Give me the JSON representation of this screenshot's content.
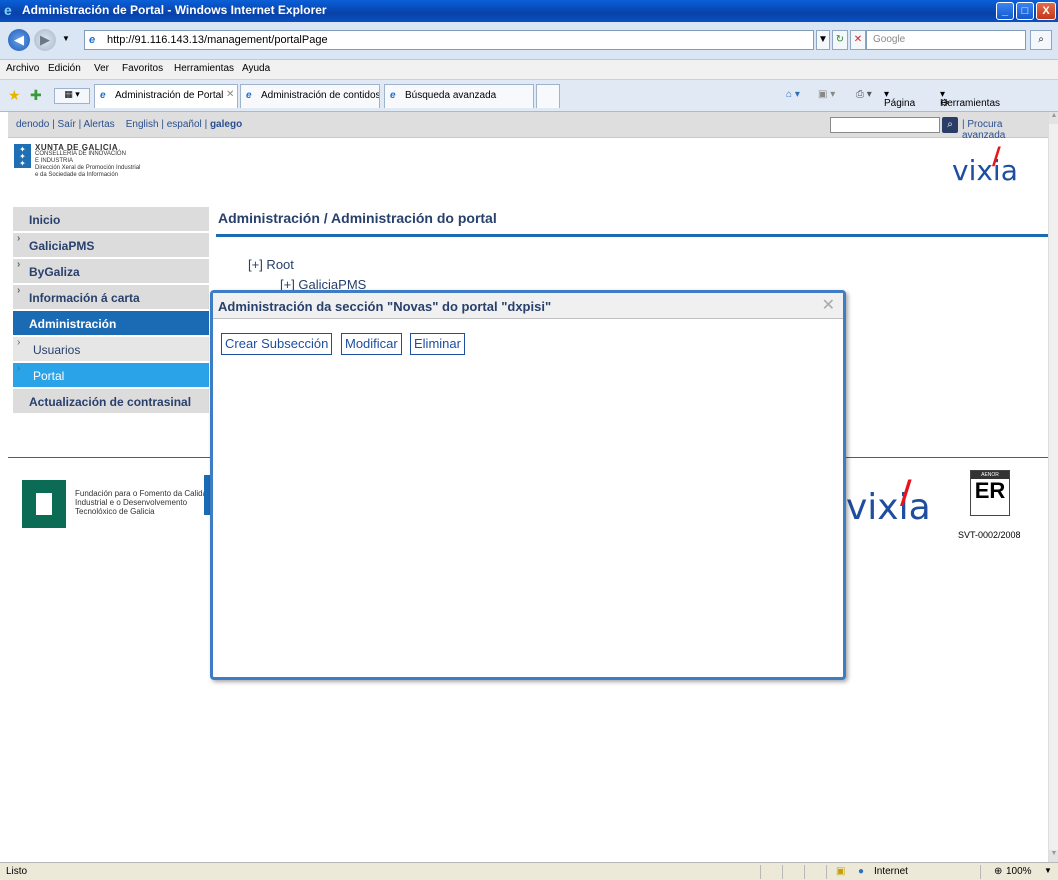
{
  "window": {
    "title": "Administración de Portal - Windows Internet Explorer",
    "minimize_label": "_",
    "maximize_label": "□",
    "close_label": "X"
  },
  "addressbar": {
    "back_glyph": "◀",
    "forward_glyph": "▶",
    "url": "http://91.116.143.13/management/portalPage",
    "refresh_glyph": "↻",
    "stop_glyph": "✕",
    "search_placeholder": "Google"
  },
  "menubar": [
    "Archivo",
    "Edición",
    "Ver",
    "Favoritos",
    "Herramientas",
    "Ayuda"
  ],
  "tabs": [
    {
      "label": "Administración de Portal",
      "active": true
    },
    {
      "label": "Administración de contidos",
      "active": false
    },
    {
      "label": "Búsqueda avanzada",
      "active": false
    }
  ],
  "toolbar": {
    "page_label": "Página",
    "tools_label": "Herramientas"
  },
  "site": {
    "topstrip": {
      "user": "denodo",
      "sair": "Saír",
      "alertas": "Alertas",
      "lang_en": "English",
      "lang_es": "español",
      "lang_gl": "galego",
      "separator": "|",
      "advanced_search": "Procura avanzada"
    },
    "xunta": {
      "name": "XUNTA DE GALICIA",
      "line1": "CONSELLERÍA DE INNOVACIÓN",
      "line2": "E INDUSTRIA",
      "line3": "Dirección Xeral de Promoción Industrial",
      "line4": "e da Sociedade da Información"
    },
    "vixia_logo": "vixia",
    "sidebar": [
      {
        "label": "Inicio",
        "type": "main"
      },
      {
        "label": "GaliciaPMS",
        "type": "arrow"
      },
      {
        "label": "ByGaliza",
        "type": "arrow"
      },
      {
        "label": "Información á carta",
        "type": "arrow"
      },
      {
        "label": "Administración",
        "type": "active"
      },
      {
        "label": "Usuarios",
        "type": "sub"
      },
      {
        "label": "Portal",
        "type": "subsel"
      },
      {
        "label": "Actualización de contrasinal",
        "type": "main"
      }
    ],
    "breadcrumb": "Administración / Administración do portal",
    "tree": {
      "root": "[+] Root",
      "child": "[+] GaliciaPMS"
    },
    "footer": {
      "fundacion": "Fundación para o Fomento da Calidade Industrial e o Desenvolvemento Tecnolóxico de Galicia",
      "aenor_top": "AENOR",
      "aenor_mark": "ER",
      "svt": "SVT-0002/2008"
    }
  },
  "modal": {
    "title": "Administración da sección \"Novas\" do portal \"dxpisi\"",
    "close_glyph": "✕",
    "buttons": {
      "crear": "Crear Subsección",
      "modificar": "Modificar",
      "eliminar": "Eliminar"
    }
  },
  "statusbar": {
    "status": "Listo",
    "zone": "Internet",
    "zoom": "100%"
  }
}
